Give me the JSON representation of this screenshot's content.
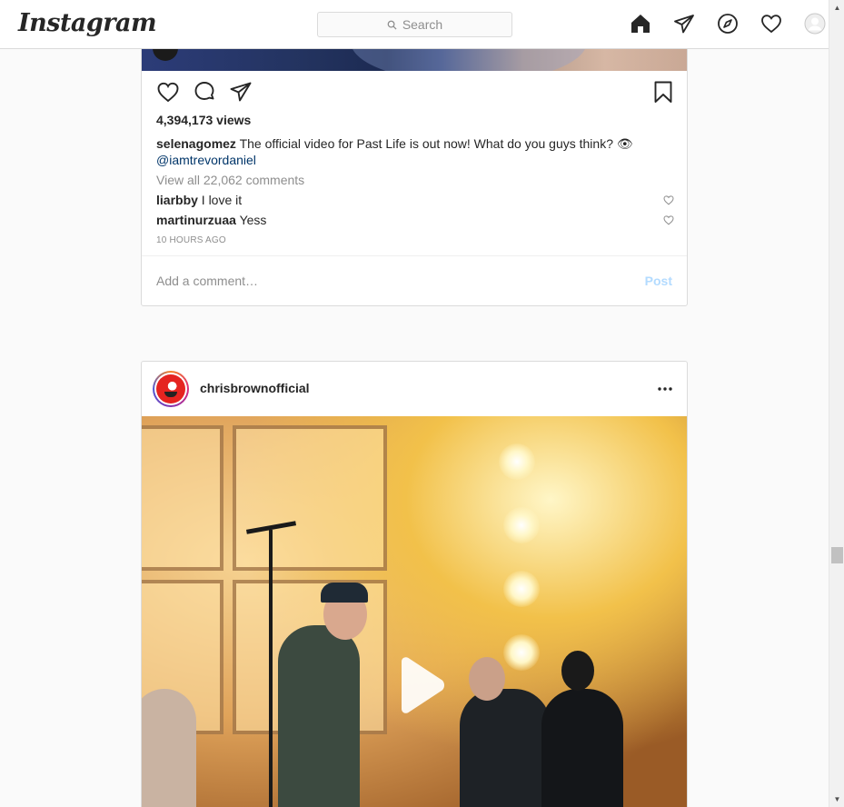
{
  "app": {
    "logo_text": "Instagram"
  },
  "search": {
    "placeholder": "Search"
  },
  "nav": {
    "icons": [
      "home-icon",
      "direct-icon",
      "explore-icon",
      "activity-heart-icon",
      "profile-avatar-icon"
    ]
  },
  "post1": {
    "views": "4,394,173 views",
    "caption_user": "selenagomez",
    "caption_text": "The official video for Past Life is out now! What do you guys think? 👁",
    "caption_mention": "@iamtrevordaniel",
    "view_all": "View all 22,062 comments",
    "comments": [
      {
        "user": "liarbby",
        "text": "I love it"
      },
      {
        "user": "martinurzuaa",
        "text": "Yess"
      }
    ],
    "timestamp": "10 HOURS AGO",
    "comment_placeholder": "Add a comment…",
    "post_label": "Post"
  },
  "post2": {
    "username": "chrisbrownofficial"
  },
  "colors": {
    "accent_link": "#003569",
    "post_button_disabled": "#b3dbff",
    "border": "#dbdbdb",
    "muted_text": "#8e8e8e"
  }
}
